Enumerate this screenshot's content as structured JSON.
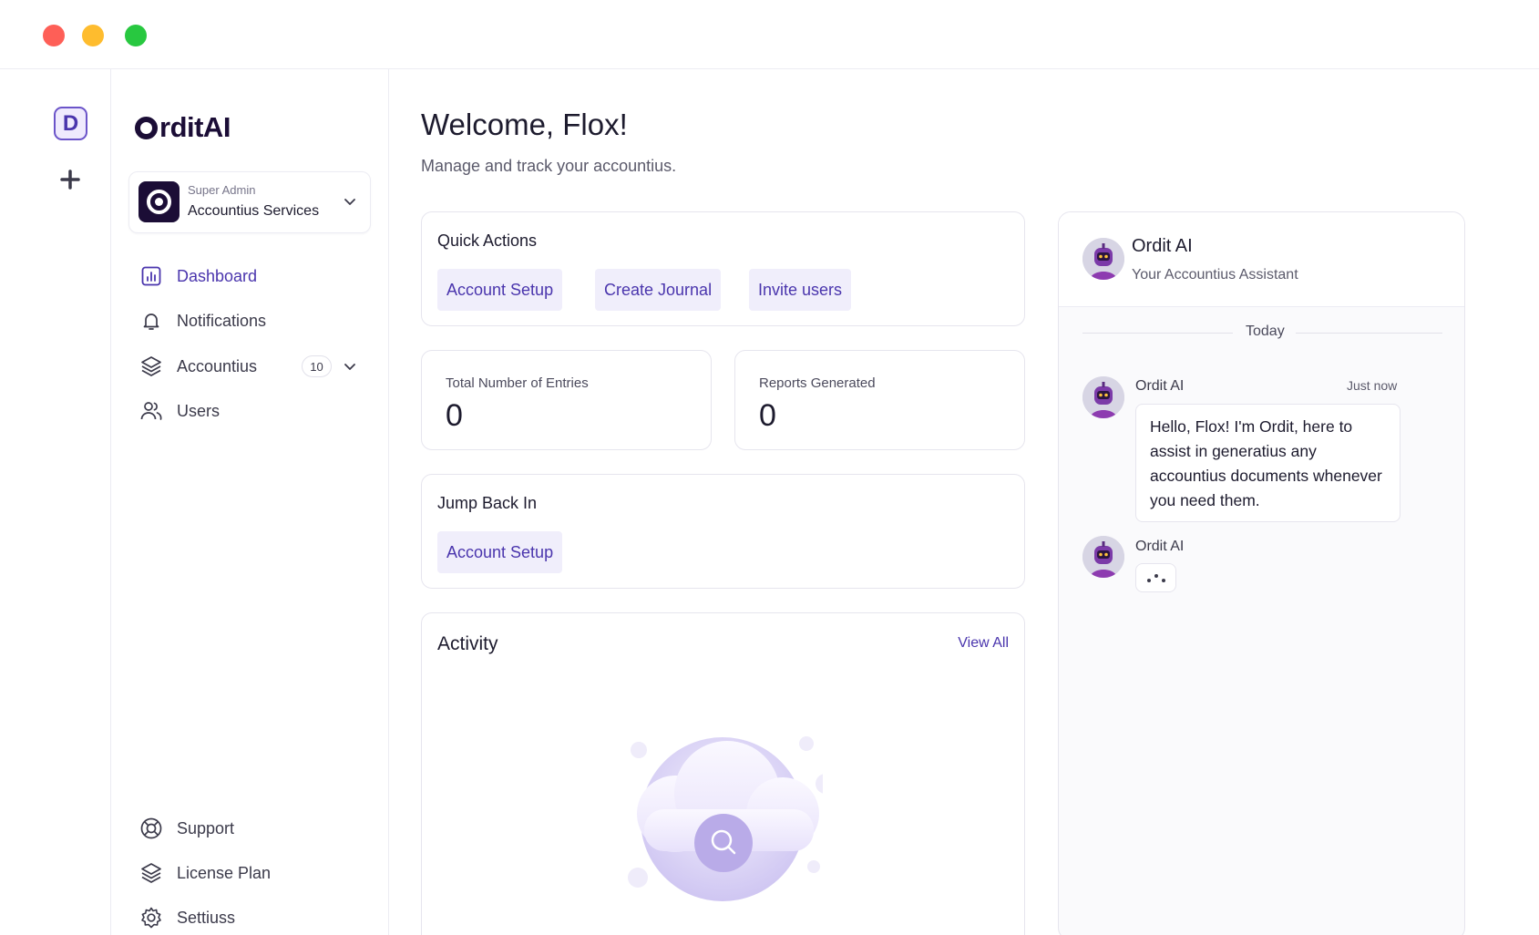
{
  "rail": {
    "workspace_initial": "D"
  },
  "brand": {
    "logo_text": "rditAI",
    "accent": "#4a35ad",
    "dark": "#1b0d36"
  },
  "org": {
    "role": "Super Admin",
    "name": "Accountius Services"
  },
  "nav": {
    "items": [
      {
        "label": "Dashboard",
        "icon": "chart-bar-icon",
        "active": true
      },
      {
        "label": "Notifications",
        "icon": "bell-icon"
      },
      {
        "label": "Accountius",
        "icon": "layers-icon",
        "count": "10"
      },
      {
        "label": "Users",
        "icon": "users-icon"
      }
    ],
    "bottom": [
      {
        "label": "Support",
        "icon": "lifebuoy-icon"
      },
      {
        "label": "License Plan",
        "icon": "layers-icon"
      },
      {
        "label": "Settiuss",
        "icon": "gear-icon"
      }
    ]
  },
  "header": {
    "title": "Welcome, Flox!",
    "subtitle": "Manage and track your accountius."
  },
  "quick_actions": {
    "title": "Quick Actions",
    "actions": [
      "Account Setup",
      "Create Journal",
      "Invite users"
    ]
  },
  "stats": [
    {
      "label": "Total Number of Entries",
      "value": "0"
    },
    {
      "label": "Reports Generated",
      "value": "0"
    }
  ],
  "jump_back": {
    "title": "Jump Back In",
    "items": [
      "Account Setup"
    ]
  },
  "activity": {
    "title": "Activity",
    "view_all": "View All"
  },
  "chat": {
    "name": "Ordit AI",
    "role": "Your Accountius Assistant",
    "day_label": "Today",
    "messages": [
      {
        "sender": "Ordit AI",
        "time": "Just now",
        "text": "Hello, Flox! I'm Ordit, here to assist in generatius any accountius documents whenever you need them."
      },
      {
        "sender": "Ordit AI",
        "typing": true
      }
    ]
  }
}
